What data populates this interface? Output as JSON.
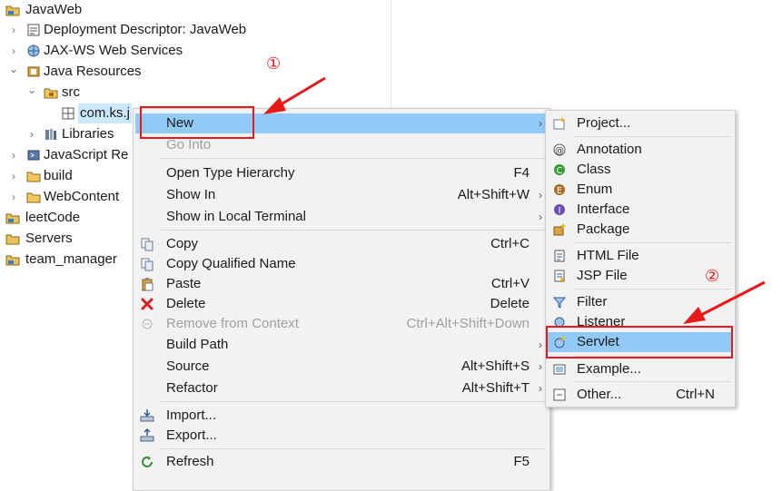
{
  "tree": {
    "items": [
      {
        "label": "JavaWeb",
        "arrow": "",
        "icon": "project-icon"
      },
      {
        "label": "Deployment Descriptor: JavaWeb",
        "arrow": "›",
        "icon": "deployment-descriptor-icon"
      },
      {
        "label": "JAX-WS Web Services",
        "arrow": "›",
        "icon": "web-services-icon"
      },
      {
        "label": "Java Resources",
        "arrow": "⌄",
        "icon": "java-resources-icon"
      },
      {
        "label": "src",
        "arrow": "⌄",
        "icon": "source-folder-icon"
      },
      {
        "label": "com.ks.j",
        "arrow": "",
        "icon": "package-icon"
      },
      {
        "label": "Libraries",
        "arrow": "›",
        "icon": "libraries-icon"
      },
      {
        "label": "JavaScript Re",
        "arrow": "›",
        "icon": "javascript-resources-icon"
      },
      {
        "label": "build",
        "arrow": "›",
        "icon": "folder-icon"
      },
      {
        "label": "WebContent",
        "arrow": "›",
        "icon": "folder-icon"
      },
      {
        "label": "leetCode",
        "arrow": "",
        "icon": "project-icon"
      },
      {
        "label": "Servers",
        "arrow": "",
        "icon": "project-icon"
      },
      {
        "label": "team_manager",
        "arrow": "",
        "icon": "project-icon"
      }
    ]
  },
  "context_menu": {
    "new": {
      "label": "New",
      "submenu": "›"
    },
    "go_into": {
      "label": "Go Into"
    },
    "open_type_hierarchy": {
      "label": "Open Type Hierarchy",
      "shortcut": "F4"
    },
    "show_in": {
      "label": "Show In",
      "shortcut": "Alt+Shift+W",
      "submenu": "›"
    },
    "show_in_local_terminal": {
      "label": "Show in Local Terminal",
      "submenu": "›"
    },
    "copy": {
      "label": "Copy",
      "shortcut": "Ctrl+C",
      "icon": "copy-icon"
    },
    "copy_qualified_name": {
      "label": "Copy Qualified Name",
      "icon": "copy-qualified-name-icon"
    },
    "paste": {
      "label": "Paste",
      "shortcut": "Ctrl+V",
      "icon": "paste-icon"
    },
    "delete": {
      "label": "Delete",
      "shortcut": "Delete",
      "icon": "delete-icon"
    },
    "remove_from_context": {
      "label": "Remove from Context",
      "shortcut": "Ctrl+Alt+Shift+Down",
      "icon": "remove-from-context-icon"
    },
    "build_path": {
      "label": "Build Path",
      "submenu": "›"
    },
    "source": {
      "label": "Source",
      "shortcut": "Alt+Shift+S",
      "submenu": "›"
    },
    "refactor": {
      "label": "Refactor",
      "shortcut": "Alt+Shift+T",
      "submenu": "›"
    },
    "import": {
      "label": "Import...",
      "icon": "import-icon"
    },
    "export": {
      "label": "Export...",
      "icon": "export-icon"
    },
    "refresh": {
      "label": "Refresh",
      "shortcut": "F5",
      "icon": "refresh-icon"
    }
  },
  "new_submenu": {
    "project": {
      "label": "Project...",
      "icon": "new-project-icon"
    },
    "annotation": {
      "label": "Annotation",
      "icon": "annotation-icon"
    },
    "class": {
      "label": "Class",
      "icon": "class-icon"
    },
    "enum": {
      "label": "Enum",
      "icon": "enum-icon"
    },
    "interface": {
      "label": "Interface",
      "icon": "interface-icon"
    },
    "package": {
      "label": "Package",
      "icon": "new-package-icon"
    },
    "html_file": {
      "label": "HTML File",
      "icon": "html-file-icon"
    },
    "jsp_file": {
      "label": "JSP File",
      "icon": "jsp-file-icon"
    },
    "filter": {
      "label": "Filter",
      "icon": "filter-icon"
    },
    "listener": {
      "label": "Listener",
      "icon": "listener-icon"
    },
    "servlet": {
      "label": "Servlet",
      "icon": "servlet-icon"
    },
    "example": {
      "label": "Example...",
      "icon": "example-icon"
    },
    "other": {
      "label": "Other...",
      "shortcut": "Ctrl+N",
      "icon": "other-icon"
    }
  },
  "annotations": {
    "marker_1": "①",
    "marker_2": "②",
    "color": "#e8191a"
  },
  "colors": {
    "highlight": "#91c9f7",
    "menu_background": "#f2f2f2",
    "selection": "#cce8ff"
  }
}
